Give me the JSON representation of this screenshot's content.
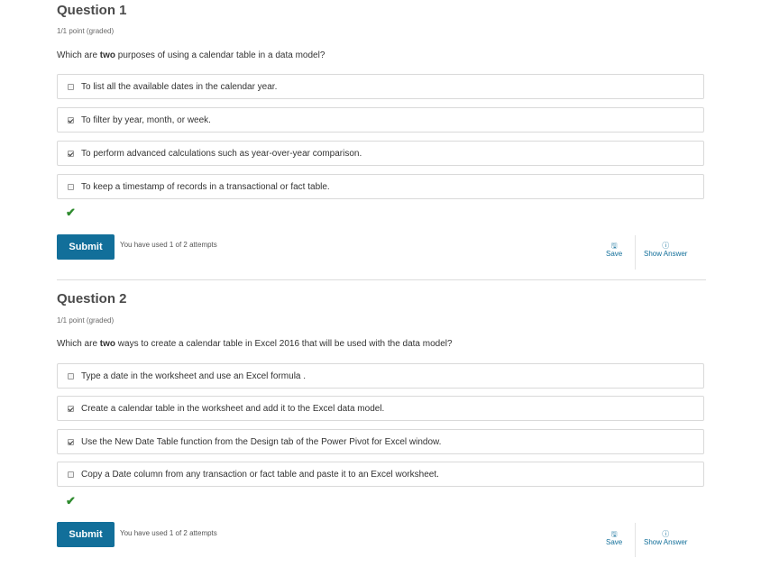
{
  "questions": [
    {
      "title": "Question 1",
      "points": "1/1 point (graded)",
      "prompt_before": "Which are ",
      "prompt_bold": "two",
      "prompt_after": " purposes of using a calendar table in a data model?",
      "choices": [
        {
          "label": "To list all the available dates in the calendar year.",
          "checked": false
        },
        {
          "label": "To filter by year, month, or week.",
          "checked": true
        },
        {
          "label": "To perform advanced calculations such as year-over-year comparison.",
          "checked": true
        },
        {
          "label": "To keep a timestamp of records in a transactional or fact table.",
          "checked": false
        }
      ],
      "submit_label": "Submit",
      "attempts": "You have used 1 of 2 attempts",
      "save_label": "Save",
      "show_answer_label": "Show Answer"
    },
    {
      "title": "Question 2",
      "points": "1/1 point (graded)",
      "prompt_before": "Which are ",
      "prompt_bold": "two",
      "prompt_after": " ways to create a calendar table in Excel 2016 that will be used with the data model?",
      "choices": [
        {
          "label": "Type a date in the worksheet and use an Excel formula .",
          "checked": false
        },
        {
          "label": "Create a calendar table in the worksheet and add it to the Excel data model.",
          "checked": true
        },
        {
          "label": "Use the New Date Table function from the Design tab of the Power Pivot for Excel window.",
          "checked": true
        },
        {
          "label": "Copy a Date column from any transaction or fact table and paste it to an Excel worksheet.",
          "checked": false
        }
      ],
      "submit_label": "Submit",
      "attempts": "You have used 1 of 2 attempts",
      "save_label": "Save",
      "show_answer_label": "Show Answer"
    }
  ],
  "icons": {
    "correct": "checkmark-icon",
    "save": "floppy-disk-icon",
    "info": "info-icon"
  },
  "colors": {
    "accent": "#126f9a",
    "correct": "#2e8b2e"
  }
}
